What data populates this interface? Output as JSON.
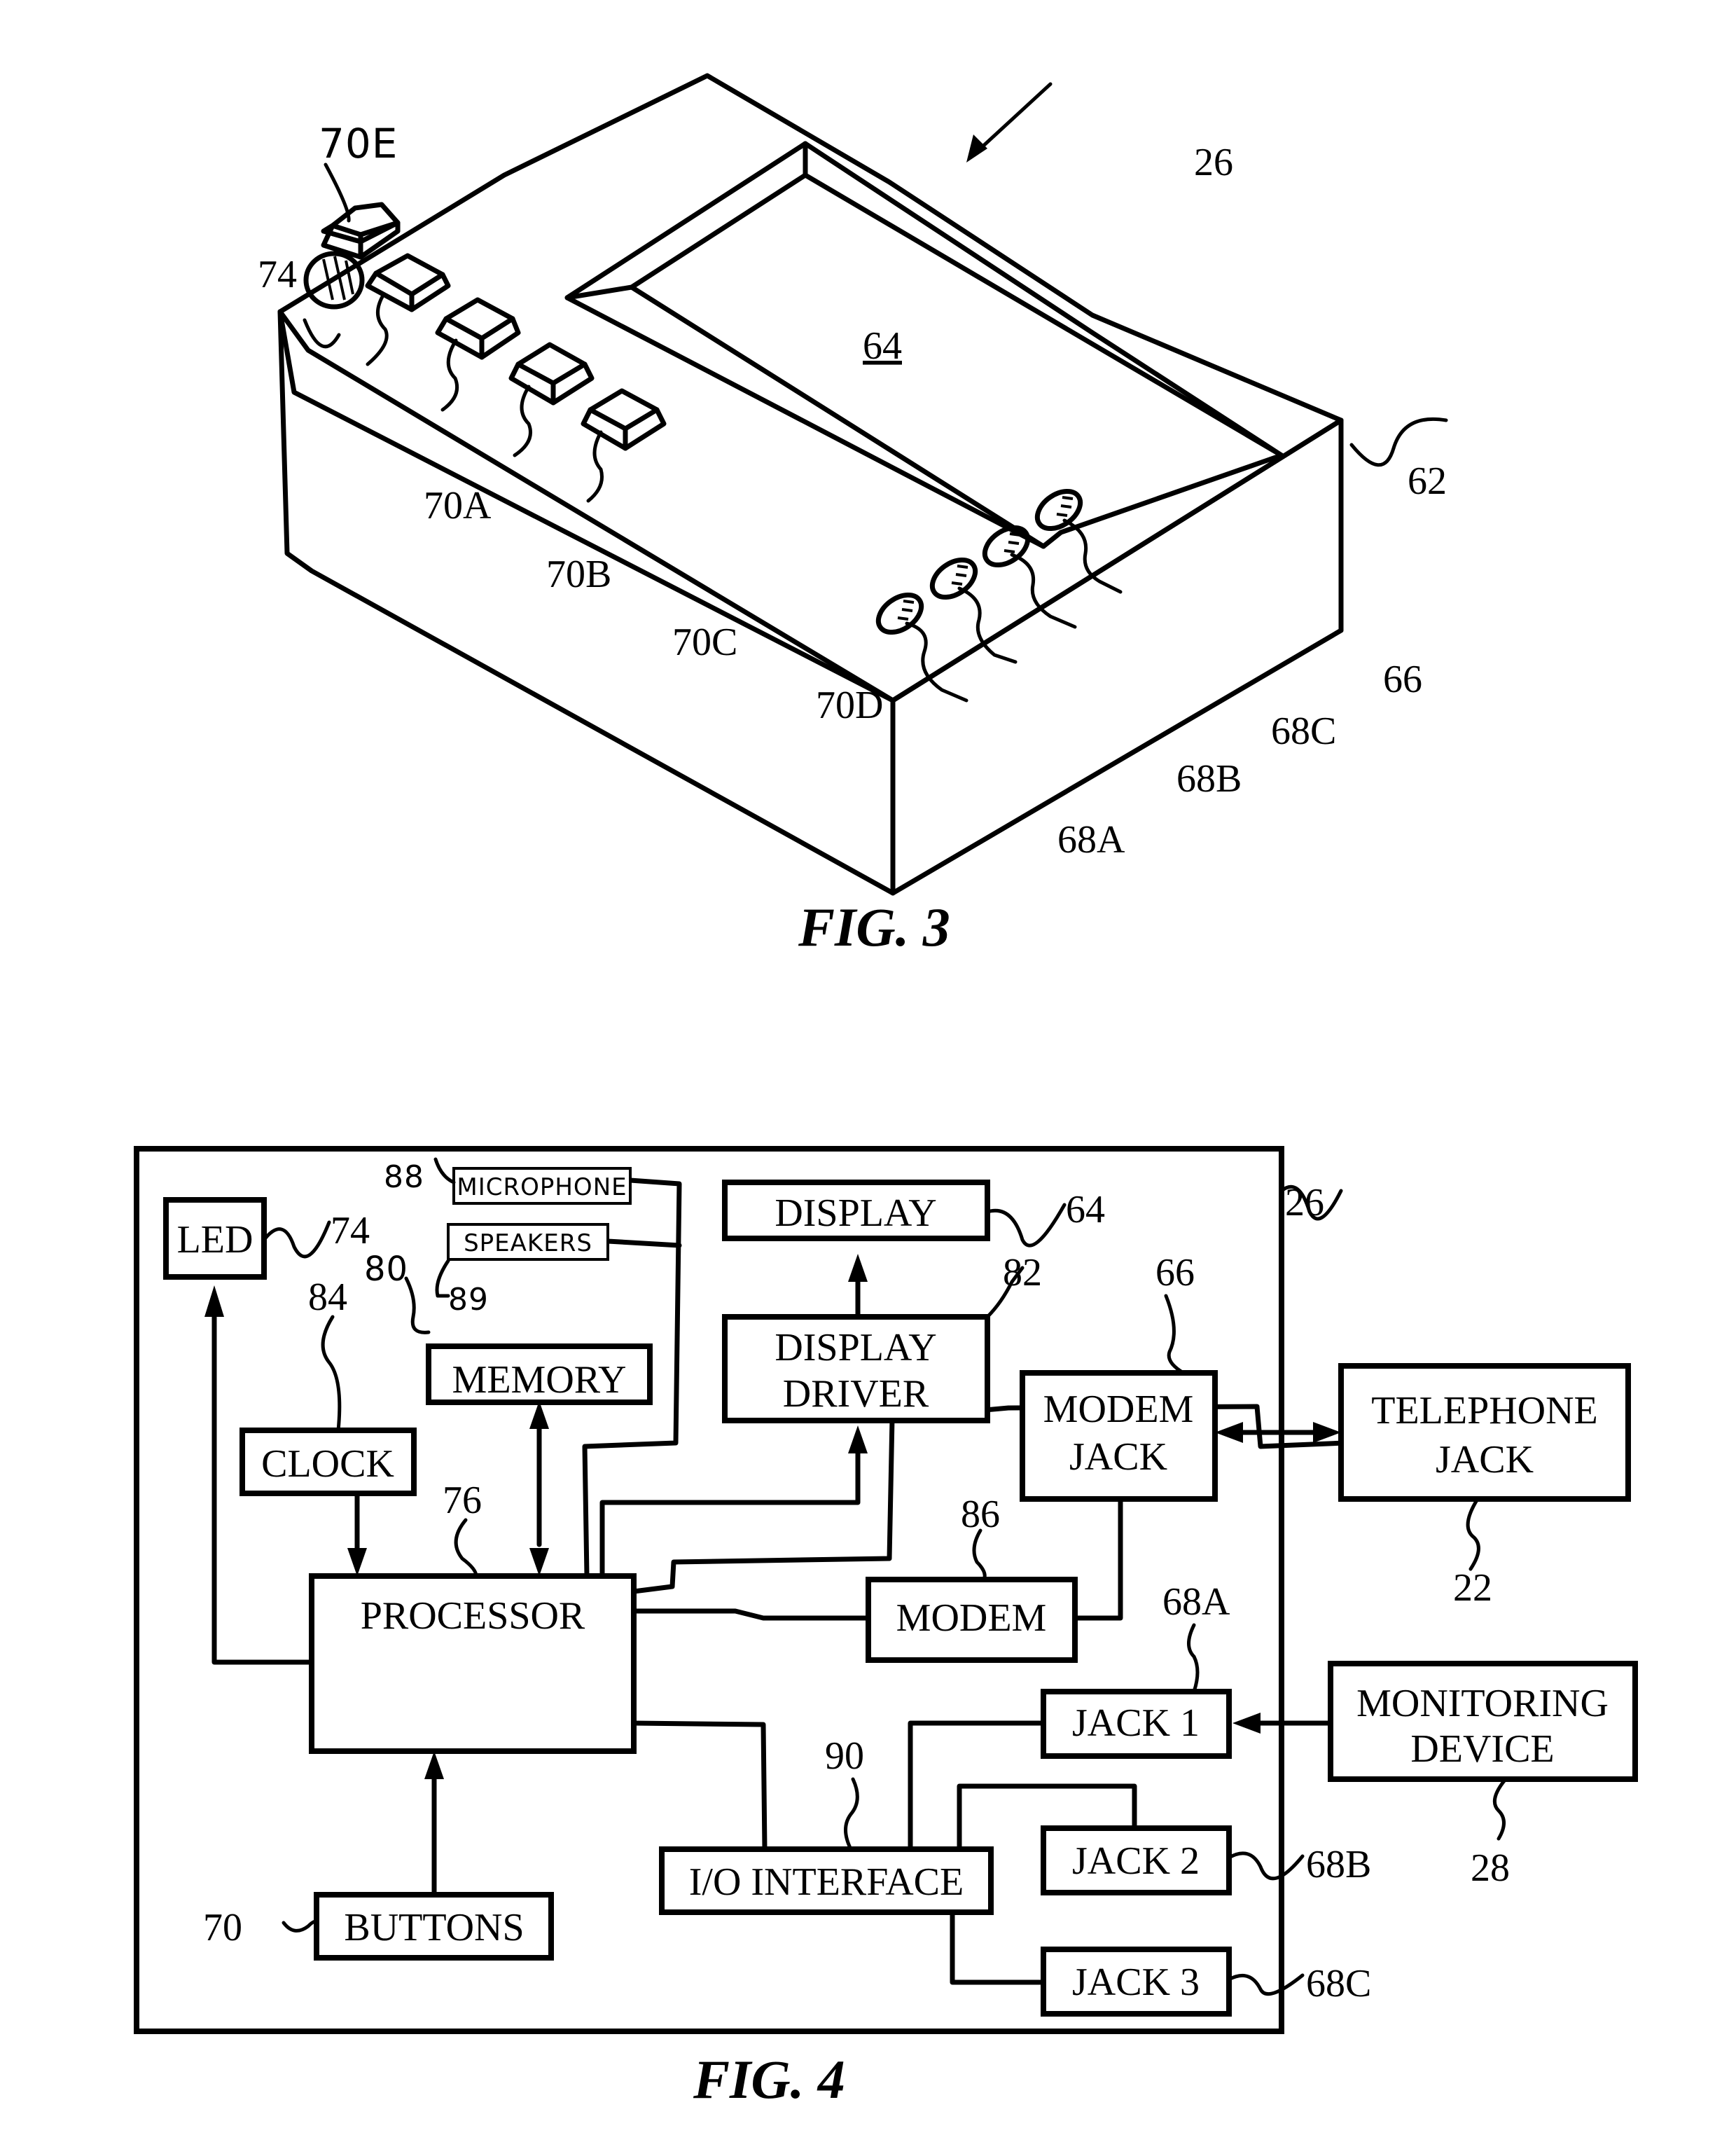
{
  "figures": {
    "fig3": {
      "caption": "FIG. 3",
      "refs": {
        "device": "26",
        "housing": "62",
        "display": "64",
        "modem_jack": "66",
        "jack_a": "68A",
        "jack_b": "68B",
        "jack_c": "68C",
        "button_a": "70A",
        "button_b": "70B",
        "button_c": "70C",
        "button_d": "70D",
        "button_e": "70E",
        "led": "74"
      }
    },
    "fig4": {
      "caption": "FIG. 4",
      "blocks": {
        "led": "LED",
        "microphone": "MICROPHONE",
        "speakers": "SPEAKERS",
        "memory": "MEMORY",
        "clock": "CLOCK",
        "processor": "PROCESSOR",
        "buttons": "BUTTONS",
        "display": "DISPLAY",
        "display_driver_1": "DISPLAY",
        "display_driver_2": "DRIVER",
        "modem_jack_1": "MODEM",
        "modem_jack_2": "JACK",
        "modem": "MODEM",
        "io_interface": "I/O INTERFACE",
        "jack1": "JACK 1",
        "jack2": "JACK 2",
        "jack3": "JACK 3",
        "telephone_jack_1": "TELEPHONE",
        "telephone_jack_2": "JACK",
        "monitoring_device_1": "MONITORING",
        "monitoring_device_2": "DEVICE"
      },
      "refs": {
        "device": "26",
        "led": "74",
        "microphone": "88",
        "speakers": "89",
        "memory": "80",
        "clock": "84",
        "processor": "76",
        "buttons": "70",
        "display": "64",
        "display_driver": "82",
        "modem_jack": "66",
        "modem": "86",
        "io_interface": "90",
        "jack1": "68A",
        "jack2": "68B",
        "jack3": "68C",
        "telephone_jack": "22",
        "monitoring_device": "28"
      }
    }
  }
}
